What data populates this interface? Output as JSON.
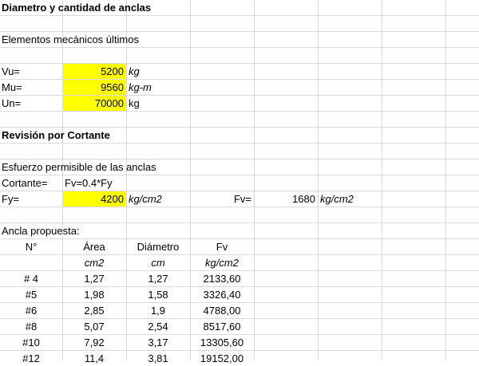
{
  "colors": {
    "highlight": "#ffff00",
    "gridline": "#d9d9d9"
  },
  "title": "Diametro y cantidad de anclas",
  "section1": {
    "heading": "Elementos mecánicos últimos",
    "rows": [
      {
        "label": "Vu=",
        "value": "5200",
        "unit": "kg"
      },
      {
        "label": "Mu=",
        "value": "9560",
        "unit": "kg-m"
      },
      {
        "label": "Un=",
        "value": "70000",
        "unit": "kg"
      }
    ]
  },
  "section2": {
    "heading": "Revisión por Cortante",
    "sub": "Esfuerzo permisible de las anclas",
    "cortante_label": "Cortante=",
    "cortante_formula": "Fv=0.4*Fy",
    "fy_label": "Fy=",
    "fy_value": "4200",
    "fy_unit": "kg/cm2",
    "fv_label": "Fv=",
    "fv_value": "1680",
    "fv_unit": "kg/cm2"
  },
  "table": {
    "caption": "Ancla propuesta:",
    "headers": [
      "N°",
      "Área",
      "Diámetro",
      "Fv"
    ],
    "units": [
      "",
      "cm2",
      "cm",
      "kg/cm2"
    ],
    "rows": [
      [
        "# 4",
        "1,27",
        "1,27",
        "2133,60"
      ],
      [
        "#5",
        "1,98",
        "1,58",
        "3326,40"
      ],
      [
        "#6",
        "2,85",
        "1,9",
        "4788,00"
      ],
      [
        "#8",
        "5,07",
        "2,54",
        "8517,60"
      ],
      [
        "#10",
        "7,92",
        "3,17",
        "13305,60"
      ],
      [
        "#12",
        "11,4",
        "3,81",
        "19152,00"
      ]
    ]
  }
}
